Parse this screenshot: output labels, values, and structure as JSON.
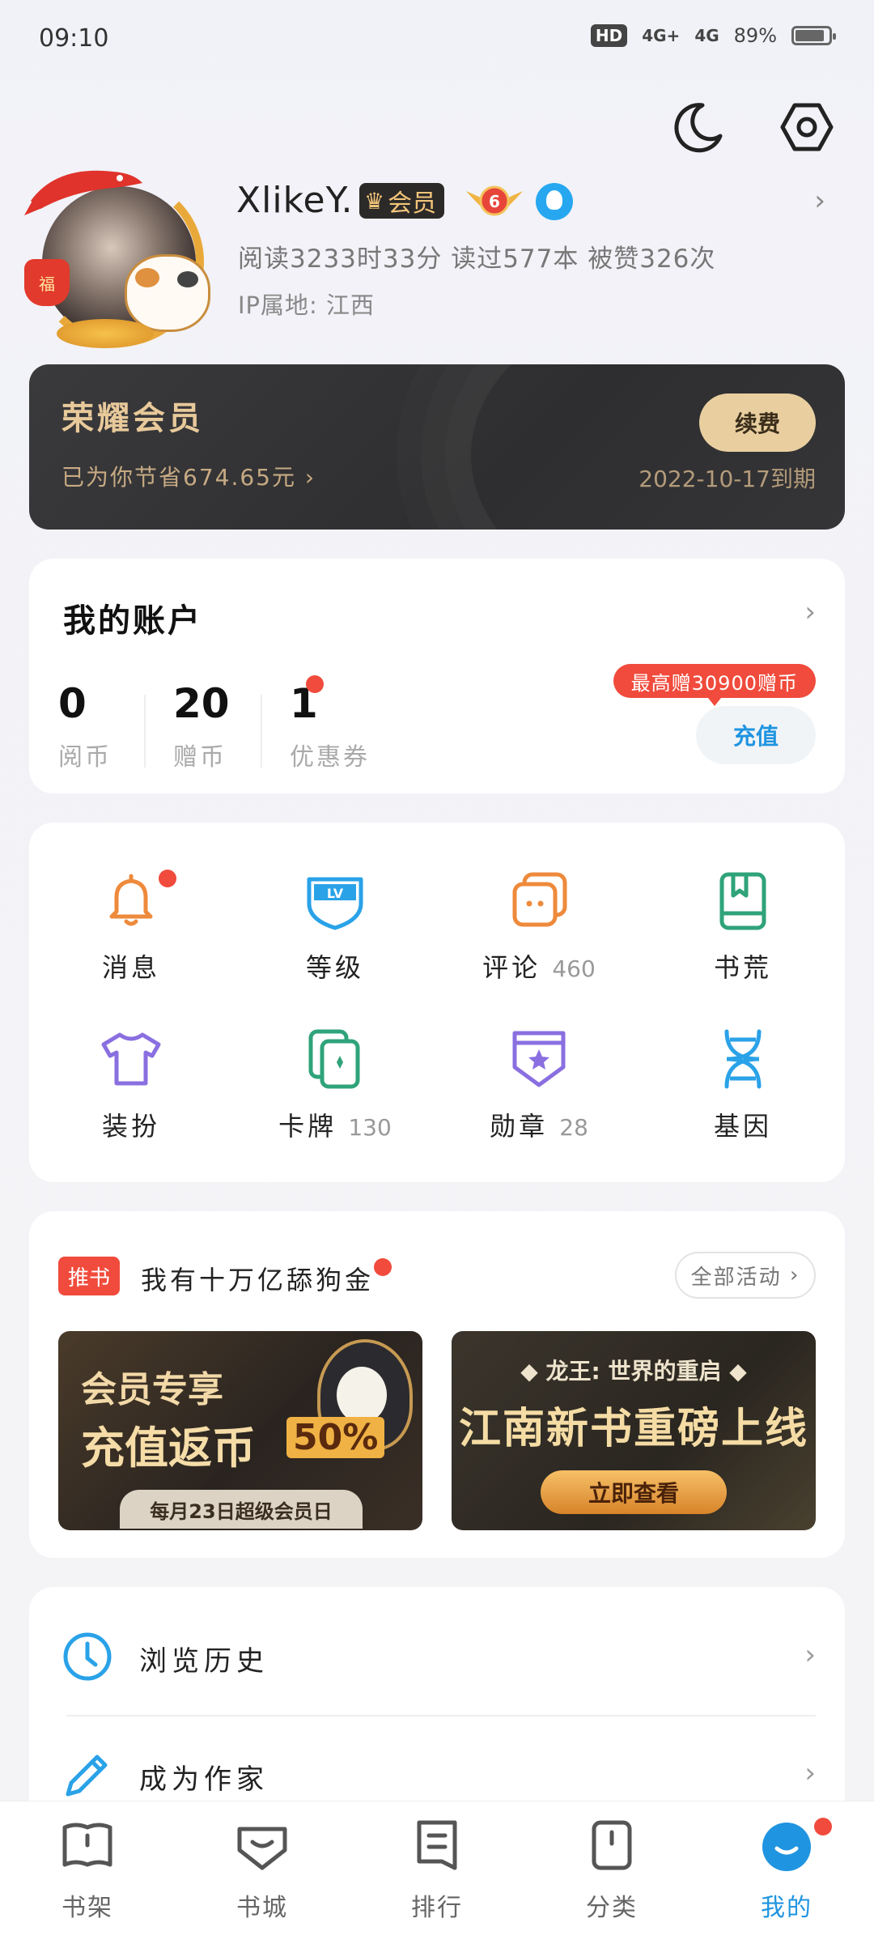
{
  "status_bar": {
    "time": "09:10",
    "hd": "HD",
    "net1": "4G+",
    "net2": "4G",
    "battery": "89%"
  },
  "profile": {
    "username": "XlikeY.",
    "vip_label": "会员",
    "level": "6",
    "stats": "阅读3233时33分   读过577本   被赞326次",
    "ip": "IP属地: 江西",
    "avatar_badge": "福"
  },
  "honor": {
    "title": "荣耀会员",
    "saved": "已为你节省674.65元 ›",
    "renew_label": "续费",
    "expire": "2022-10-17到期"
  },
  "account": {
    "title": "我的账户",
    "items": [
      {
        "value": "0",
        "label": "阅币"
      },
      {
        "value": "20",
        "label": "赠币"
      },
      {
        "value": "1",
        "label": "优惠券"
      }
    ],
    "promo": "最高赠30900赠币",
    "recharge_label": "充值"
  },
  "grid": [
    {
      "label": "消息",
      "count": "",
      "icon": "bell-icon",
      "color": "#ee8a3c"
    },
    {
      "label": "等级",
      "count": "",
      "icon": "level-shield-icon",
      "color": "#2aa2e8"
    },
    {
      "label": "评论",
      "count": "460",
      "icon": "comment-icon",
      "color": "#ee8a3c"
    },
    {
      "label": "书荒",
      "count": "",
      "icon": "book-icon",
      "color": "#2fa37a"
    },
    {
      "label": "装扮",
      "count": "",
      "icon": "tshirt-icon",
      "color": "#8a6fe0"
    },
    {
      "label": "卡牌",
      "count": "130",
      "icon": "card-icon",
      "color": "#2fa37a"
    },
    {
      "label": "勋章",
      "count": "28",
      "icon": "medal-icon",
      "color": "#8a6fe0"
    },
    {
      "label": "基因",
      "count": "",
      "icon": "dna-icon",
      "color": "#2aa2e8"
    }
  ],
  "activity": {
    "tag": "推书",
    "title": "我有十万亿舔狗金",
    "all_label": "全部活动",
    "banner1": {
      "line1": "会员专享",
      "line2": "充值返币",
      "pct": "50%",
      "footer": "每月23日超级会员日"
    },
    "banner2": {
      "sub": "◆ 龙王: 世界的重启 ◆",
      "main": "江南新书重磅上线",
      "button": "立即查看"
    }
  },
  "list": [
    {
      "label": "浏览历史",
      "icon": "clock-icon"
    },
    {
      "label": "成为作家",
      "icon": "pencil-icon"
    }
  ],
  "nav": [
    {
      "label": "书架",
      "icon": "bookshelf-icon",
      "active": false
    },
    {
      "label": "书城",
      "icon": "bookstore-icon",
      "active": false
    },
    {
      "label": "排行",
      "icon": "ranking-icon",
      "active": false
    },
    {
      "label": "分类",
      "icon": "category-icon",
      "active": false
    },
    {
      "label": "我的",
      "icon": "profile-face-icon",
      "active": true
    }
  ],
  "colors": {
    "accent": "#1f94e0",
    "red": "#f04b3c",
    "gold": "#e8c99a"
  }
}
